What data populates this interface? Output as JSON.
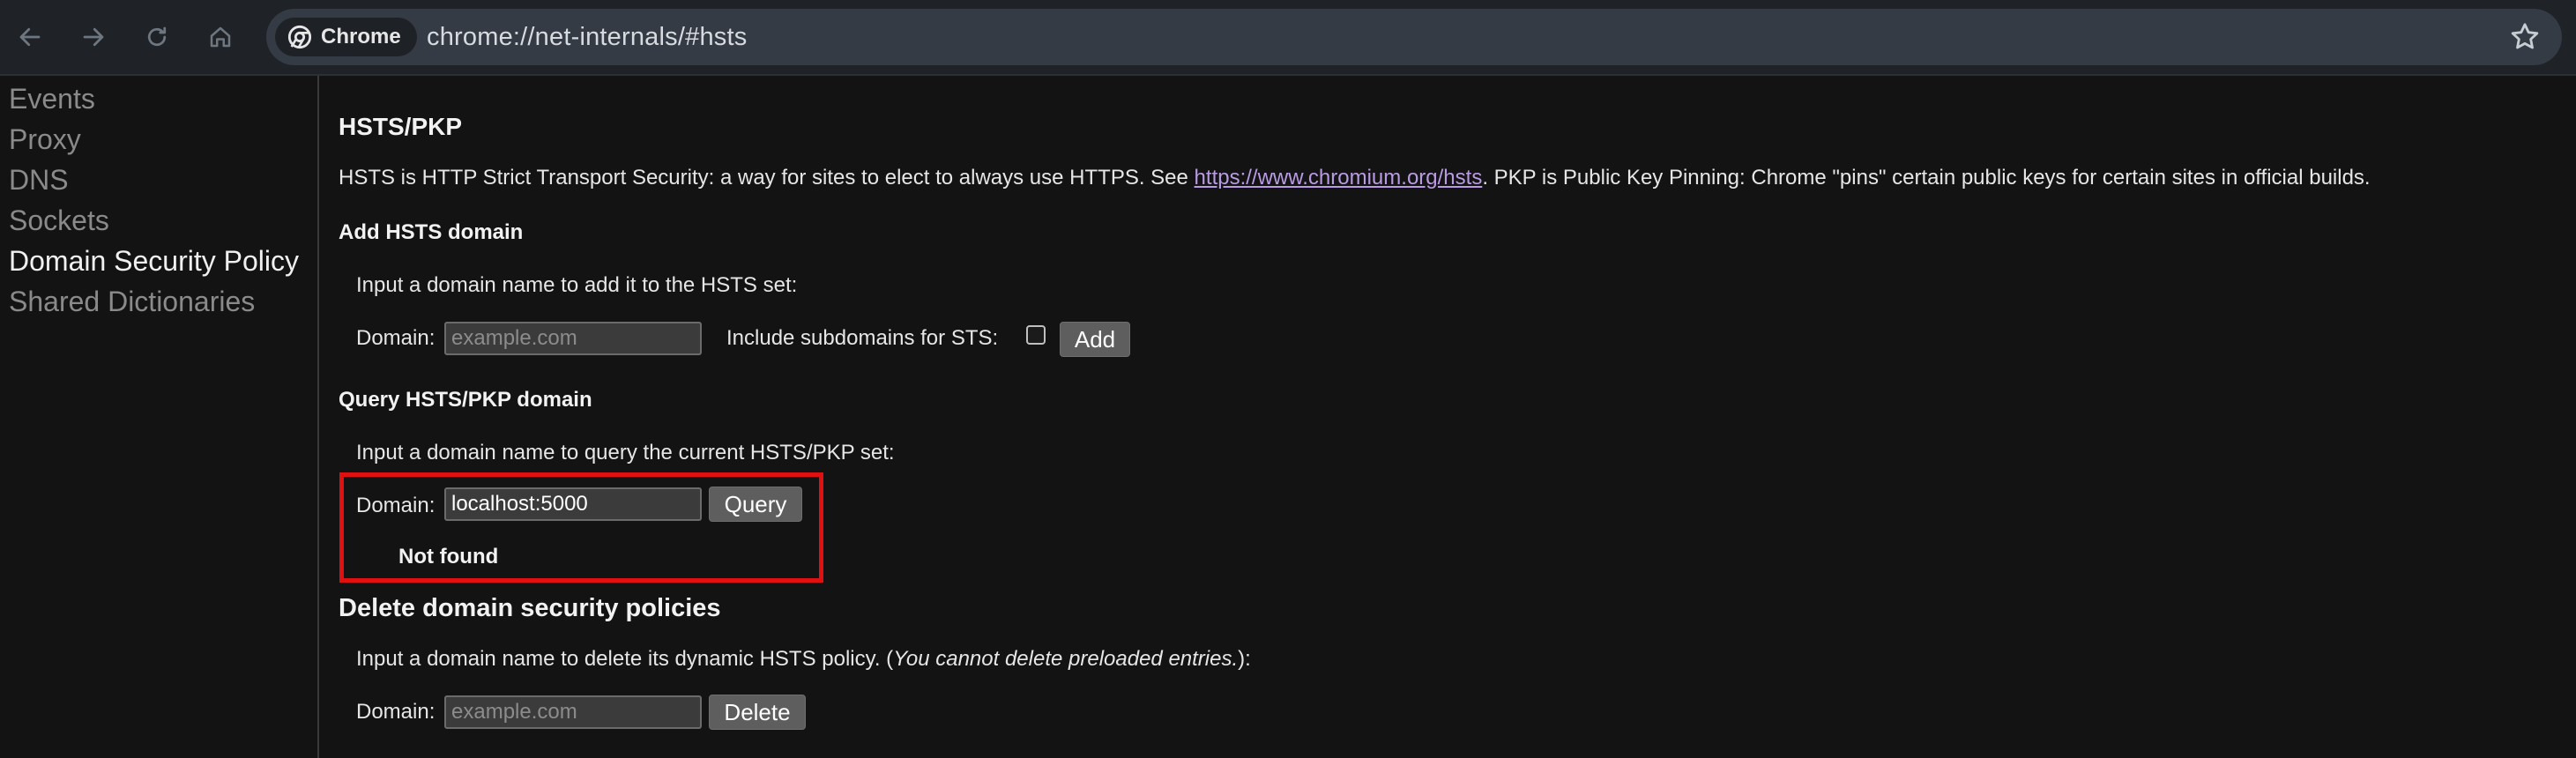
{
  "browser": {
    "chip_label": "Chrome",
    "url": "chrome://net-internals/#hsts",
    "icons": [
      "back-arrow-icon",
      "forward-arrow-icon",
      "reload-icon",
      "home-icon",
      "chrome-logo-icon",
      "star-icon"
    ]
  },
  "sidebar": {
    "items": [
      {
        "label": "Events"
      },
      {
        "label": "Proxy"
      },
      {
        "label": "DNS"
      },
      {
        "label": "Sockets"
      },
      {
        "label": "Domain Security Policy",
        "active": true
      },
      {
        "label": "Shared Dictionaries"
      }
    ]
  },
  "hsts": {
    "title": "HSTS/PKP",
    "desc_before": "HSTS is HTTP Strict Transport Security: a way for sites to elect to always use HTTPS. See ",
    "desc_link": "https://www.chromium.org/hsts",
    "desc_after": ". PKP is Public Key Pinning: Chrome \"pins\" certain public keys for certain sites in official builds.",
    "add": {
      "title": "Add HSTS domain",
      "instruction": "Input a domain name to add it to the HSTS set:",
      "domain_label": "Domain:",
      "placeholder": "example.com",
      "value": "",
      "subdomains_label": "Include subdomains for STS:",
      "subdomains_checked": false,
      "button": "Add"
    },
    "query": {
      "title": "Query HSTS/PKP domain",
      "instruction": "Input a domain name to query the current HSTS/PKP set:",
      "domain_label": "Domain:",
      "value": "localhost:5000",
      "button": "Query",
      "result": "Not found"
    }
  },
  "delete": {
    "title": "Delete domain security policies",
    "instruction_before": "Input a domain name to delete its dynamic HSTS policy. (",
    "instruction_italic": "You cannot delete preloaded entries.",
    "instruction_after": "):",
    "domain_label": "Domain:",
    "placeholder": "example.com",
    "value": "",
    "button": "Delete"
  },
  "colors": {
    "highlight": "#e01010",
    "link": "#b89be3",
    "background": "#131313"
  }
}
